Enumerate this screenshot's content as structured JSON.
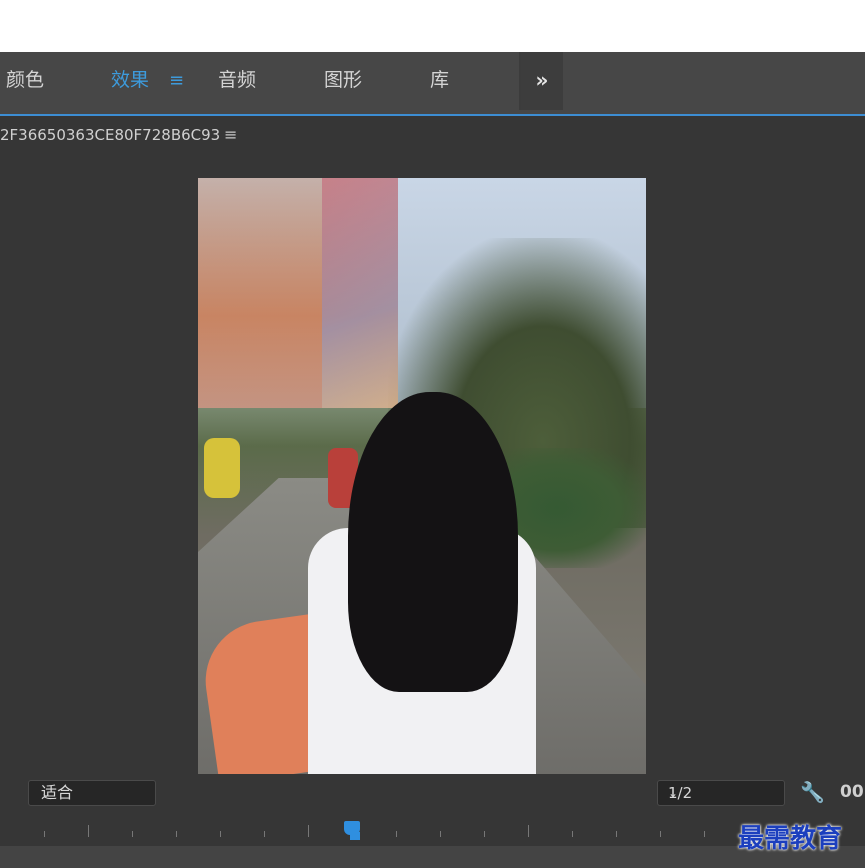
{
  "tabs": [
    {
      "label": "颜色",
      "active": false
    },
    {
      "label": "效果",
      "active": true
    },
    {
      "label": "音频",
      "active": false
    },
    {
      "label": "图形",
      "active": false
    },
    {
      "label": "库",
      "active": false
    }
  ],
  "tab_menu_glyph": "≡",
  "overflow_glyph": "»",
  "colors": {
    "accent": "#3d9bdc",
    "panel_bg": "#363636",
    "tabbar_bg": "#474747"
  },
  "monitor": {
    "sequence_name": "2F36650363CE80F728B6C93",
    "menu_glyph": "≡",
    "fit_value": "适合",
    "resolution_value": "1/2",
    "timecode_partial": "00",
    "wrench_glyph": "🔧"
  },
  "watermark": "最需教育"
}
